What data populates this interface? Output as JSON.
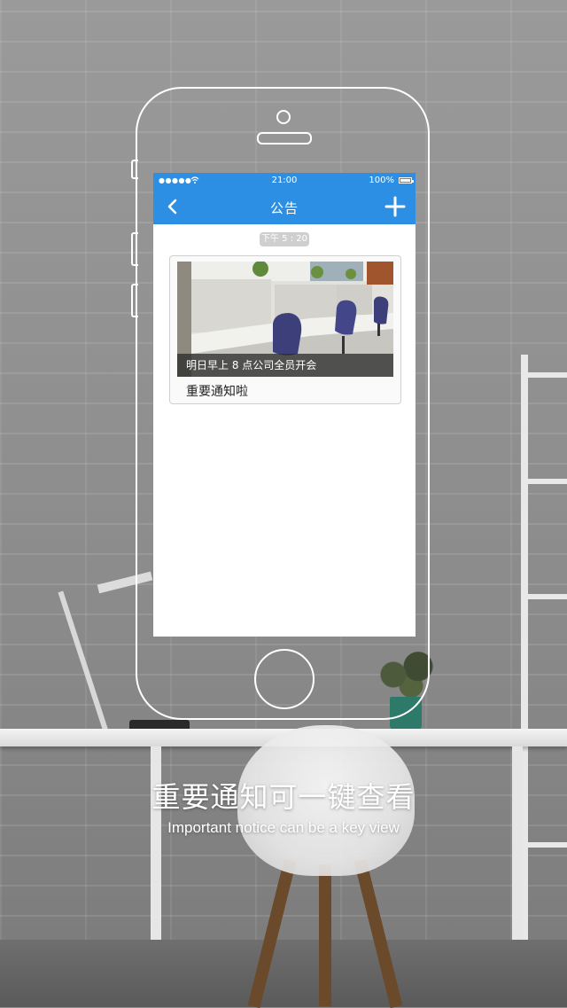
{
  "status_bar": {
    "signal": "●●●●●",
    "time": "21:00",
    "battery": "100%"
  },
  "nav": {
    "title": "公告",
    "back_icon": "chevron-left-icon",
    "add_icon": "plus-icon"
  },
  "feed": {
    "timestamp": "下午 5 : 20",
    "announcement": {
      "image_caption": "明日早上 8 点公司全员开会",
      "title": "重要通知啦"
    }
  },
  "promo": {
    "headline": "重要通知可一键查看",
    "subline": "Important notice can be a key view"
  },
  "colors": {
    "accent": "#2d8fe3"
  }
}
